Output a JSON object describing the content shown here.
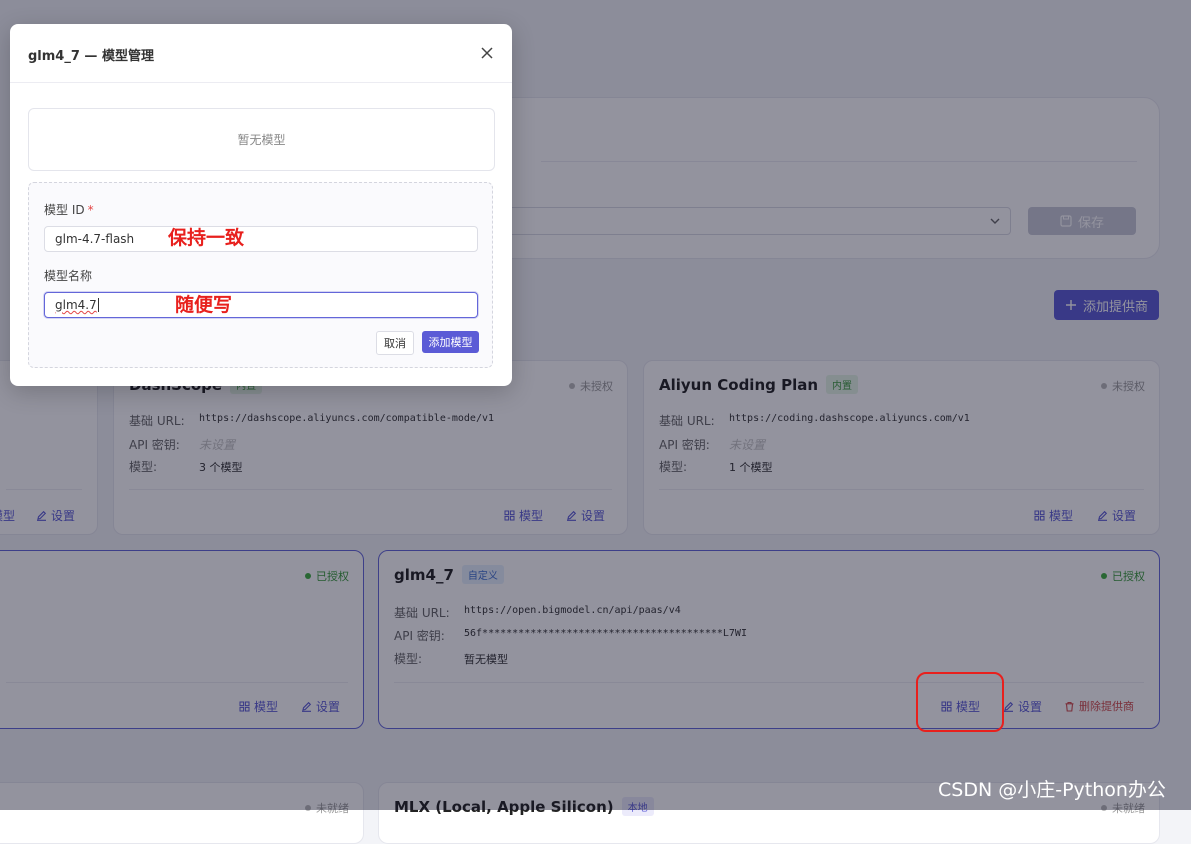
{
  "modal": {
    "title": "glm4_7 — 模型管理",
    "empty_text": "暂无模型",
    "model_id_label": "模型 ID",
    "required_mark": "*",
    "model_id_value": "glm-4.7-flash",
    "model_name_label": "模型名称",
    "model_name_value": "glm4.7",
    "cancel_label": "取消",
    "add_model_label": "添加模型"
  },
  "annotations": {
    "id_note": "保持一致",
    "name_note": "随便写"
  },
  "background": {
    "save_label": "保存",
    "add_provider_label": "添加提供商"
  },
  "cards": {
    "dashscope": {
      "name": "DashScope",
      "badge": "内置",
      "status": "未授权",
      "base_url_label": "基础 URL:",
      "base_url": "https://dashscope.aliyuncs.com/compatible-mode/v1",
      "api_key_label": "API 密钥:",
      "api_key": "未设置",
      "models_label": "模型:",
      "models": "3 个模型",
      "models_btn": "模型",
      "settings_btn": "设置"
    },
    "aliyun": {
      "name": "Aliyun Coding Plan",
      "badge": "内置",
      "status": "未授权",
      "base_url_label": "基础 URL:",
      "base_url": "https://coding.dashscope.aliyuncs.com/v1",
      "api_key_label": "API 密钥:",
      "api_key": "未设置",
      "models_label": "模型:",
      "models": "1 个模型",
      "models_btn": "模型",
      "settings_btn": "设置"
    },
    "left_top": {
      "models_btn": "模型",
      "settings_btn": "设置"
    },
    "left_mid": {
      "status": "已授权",
      "models_btn": "模型",
      "settings_btn": "设置"
    },
    "glm": {
      "name": "glm4_7",
      "badge": "自定义",
      "status": "已授权",
      "base_url_label": "基础 URL:",
      "base_url": "https://open.bigmodel.cn/api/paas/v4",
      "api_key_label": "API 密钥:",
      "api_key": "56f****************************************L7WI",
      "models_label": "模型:",
      "models": "暂无模型",
      "models_btn": "模型",
      "settings_btn": "设置",
      "delete_btn": "删除提供商"
    },
    "left_bottom": {
      "status": "未就绪"
    },
    "mlx": {
      "name": "MLX (Local, Apple Silicon)",
      "badge": "本地",
      "status": "未就绪"
    }
  },
  "watermark": "CSDN @小庄-Python办公",
  "colors": {
    "accent": "#5b5bd6",
    "authorized": "#3fb03f",
    "danger": "#d14a4a",
    "annotation": "#e8201d"
  },
  "icons": [
    "chevron-down-icon",
    "save-icon",
    "plus-icon",
    "grid-icon",
    "edit-icon",
    "trash-icon",
    "close-icon"
  ]
}
